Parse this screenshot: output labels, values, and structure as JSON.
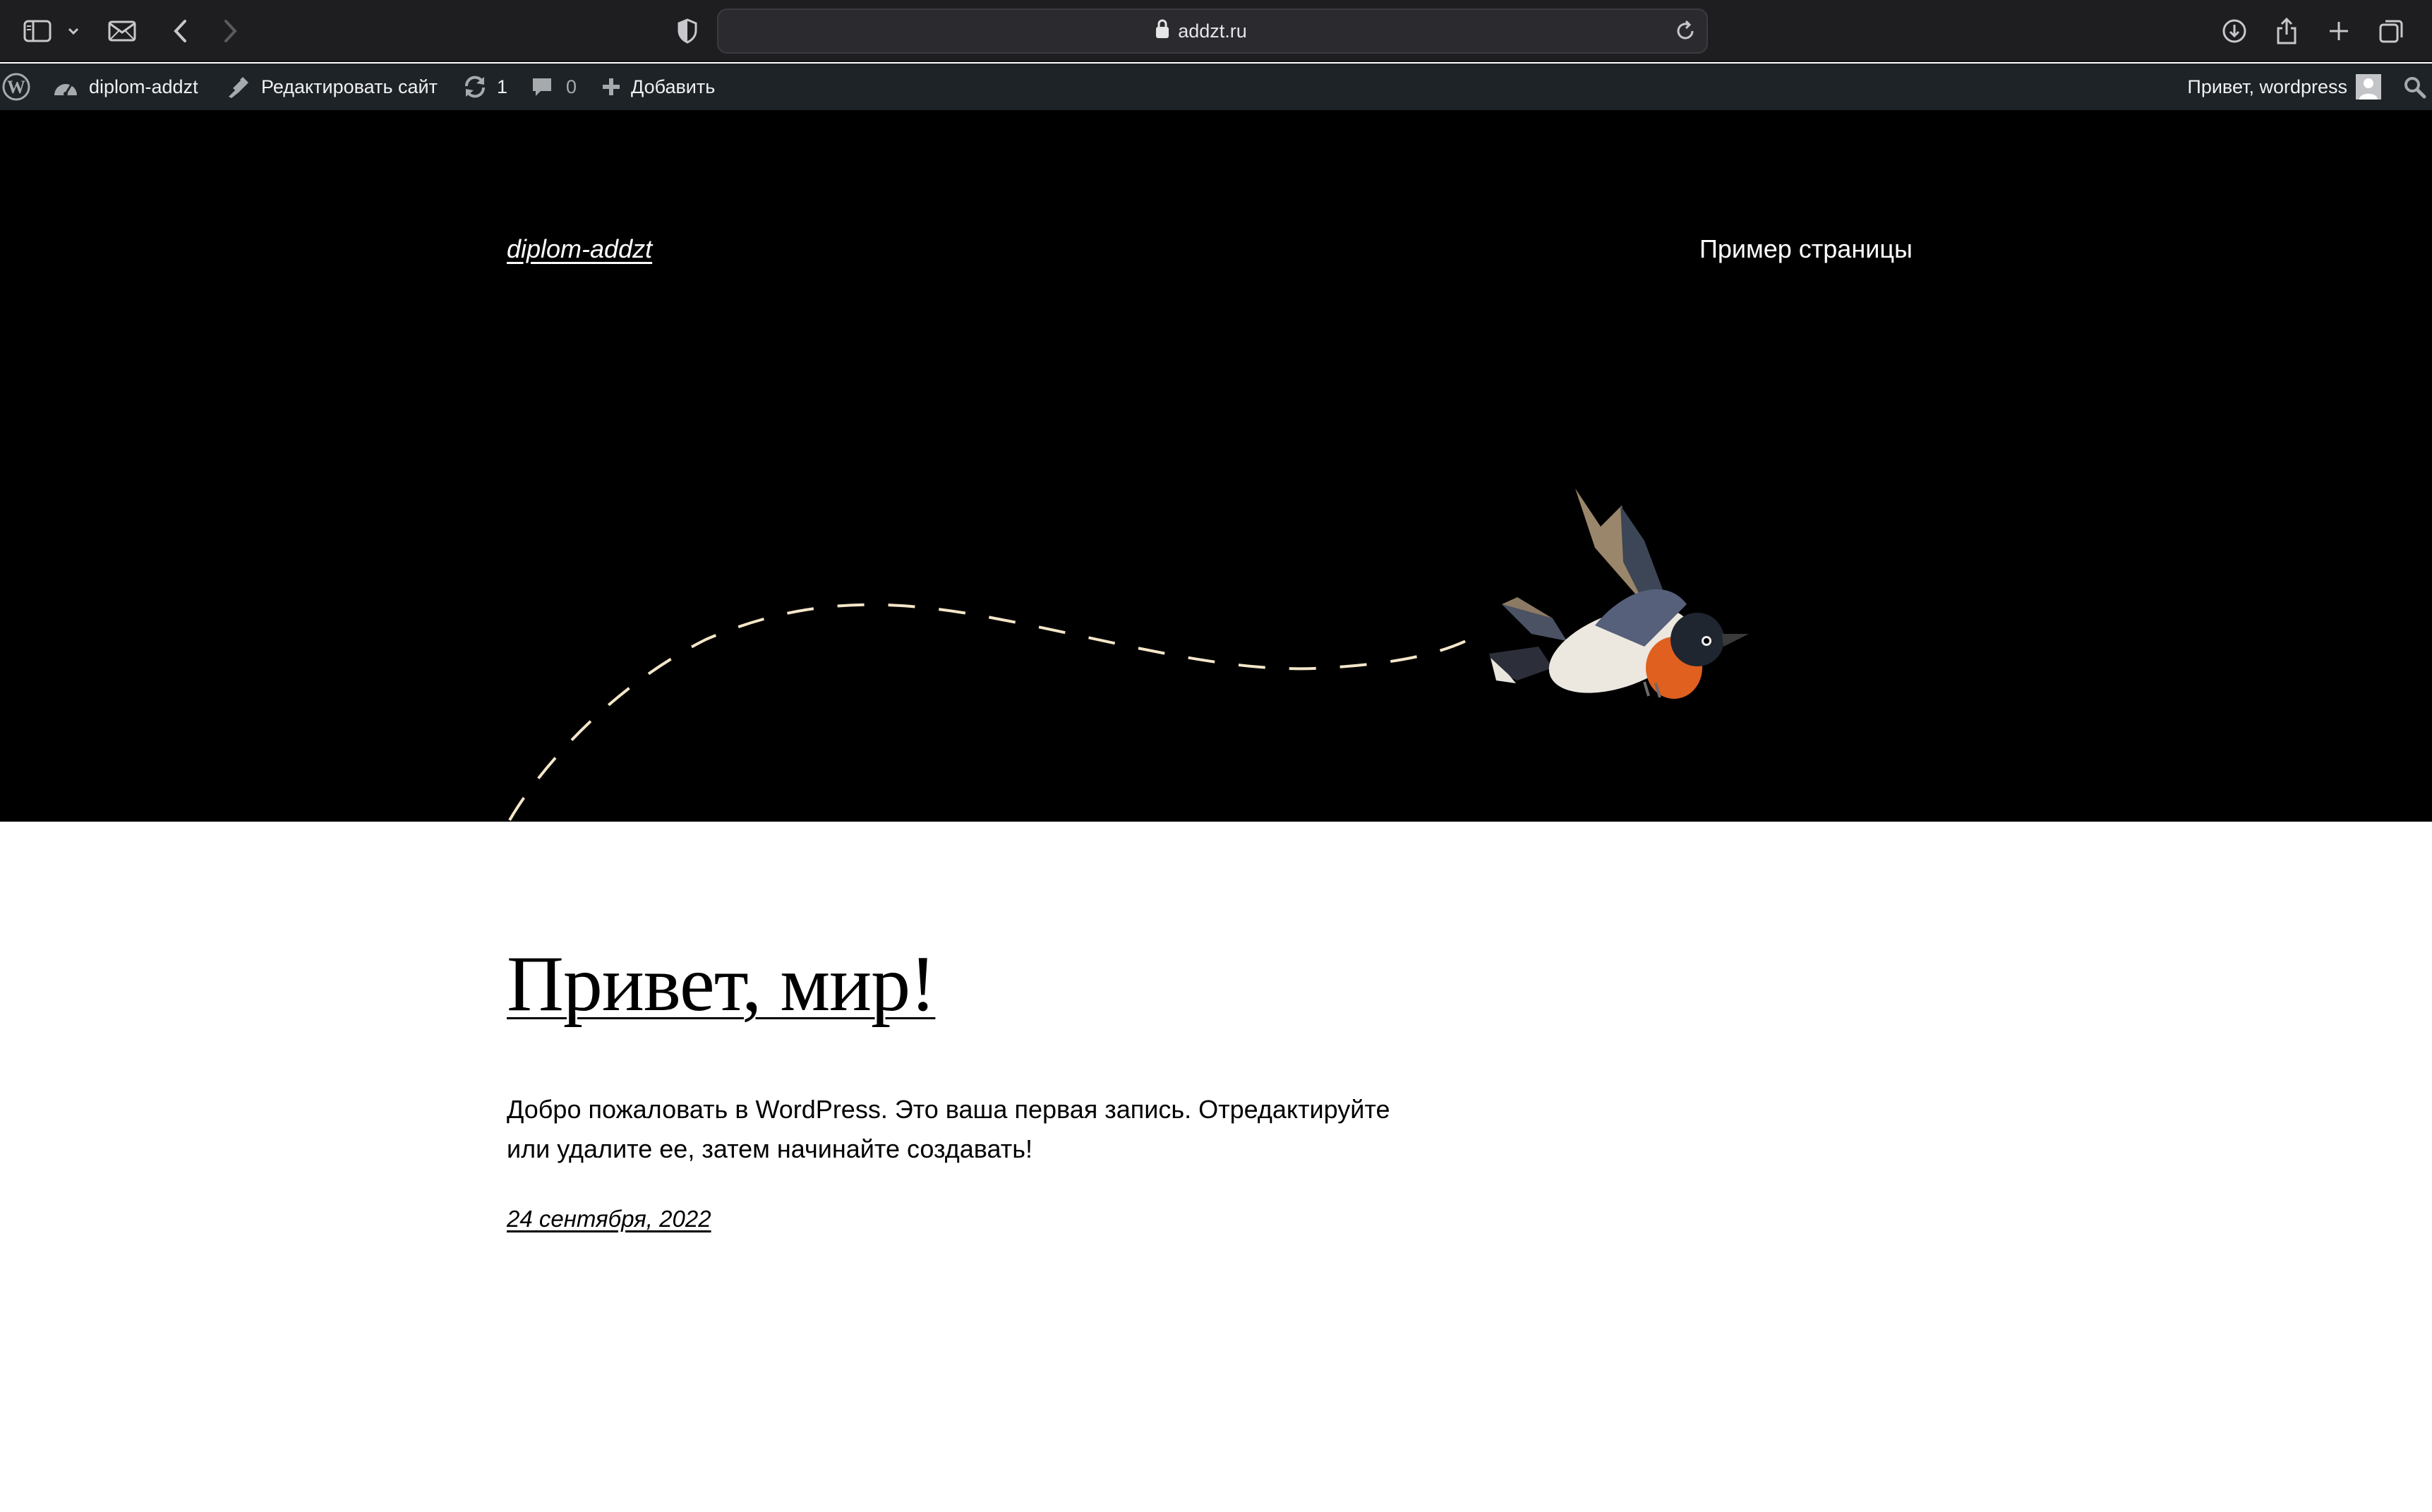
{
  "browser": {
    "url": "addzt.ru",
    "icons": [
      "sidebar-icon",
      "chevron-down-icon",
      "mail-icon",
      "back-icon",
      "forward-icon",
      "privacy-shield-icon",
      "lock-icon",
      "reload-icon",
      "download-icon",
      "share-icon",
      "new-tab-icon",
      "tab-overview-icon"
    ]
  },
  "admin_bar": {
    "site_name": "diplom-addzt",
    "edit_site": "Редактировать сайт",
    "updates_count": "1",
    "comments_count": "0",
    "add_new": "Добавить",
    "greeting": "Привет, wordpress",
    "icons": [
      "wordpress-logo-icon",
      "dashboard-icon",
      "brush-icon",
      "updates-icon",
      "comment-icon",
      "plus-icon",
      "avatar-icon",
      "search-icon"
    ]
  },
  "site": {
    "title": "diplom-addzt",
    "nav": [
      "Пример страницы"
    ],
    "header_bg": "#000000"
  },
  "post": {
    "title": "Привет, мир!",
    "excerpt_line1": "Добро пожаловать в WordPress. Это ваша первая запись. Отредактируйте",
    "excerpt_line2": "или удалите ее, затем начинайте создавать!",
    "date": "24 сентября, 2022"
  }
}
